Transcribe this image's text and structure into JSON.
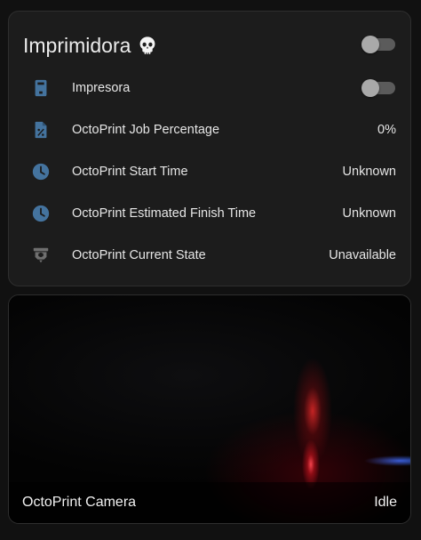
{
  "card": {
    "title": "Imprimidora",
    "title_emoji": "skull",
    "title_toggle_on": false
  },
  "entities": [
    {
      "icon": "printer-3d-icon",
      "label": "Impresora",
      "control": "toggle",
      "toggle_on": false,
      "icon_color": "#44739e"
    },
    {
      "icon": "file-percent-icon",
      "label": "OctoPrint Job Percentage",
      "value": "0%",
      "icon_color": "#44739e"
    },
    {
      "icon": "clock-icon",
      "label": "OctoPrint Start Time",
      "value": "Unknown",
      "icon_color": "#44739e"
    },
    {
      "icon": "clock-icon",
      "label": "OctoPrint Estimated Finish Time",
      "value": "Unknown",
      "icon_color": "#44739e"
    },
    {
      "icon": "printer-3d-nozzle-icon",
      "label": "OctoPrint Current State",
      "value": "Unavailable",
      "icon_color": "#6f6f6f"
    }
  ],
  "camera": {
    "title": "OctoPrint Camera",
    "state": "Idle"
  },
  "colors": {
    "background": "#111111",
    "card": "#1c1c1c",
    "icon_active": "#44739e",
    "icon_unavailable": "#6f6f6f",
    "toggle_track": "#5b5b5b",
    "toggle_knob": "#a9a9a9"
  }
}
